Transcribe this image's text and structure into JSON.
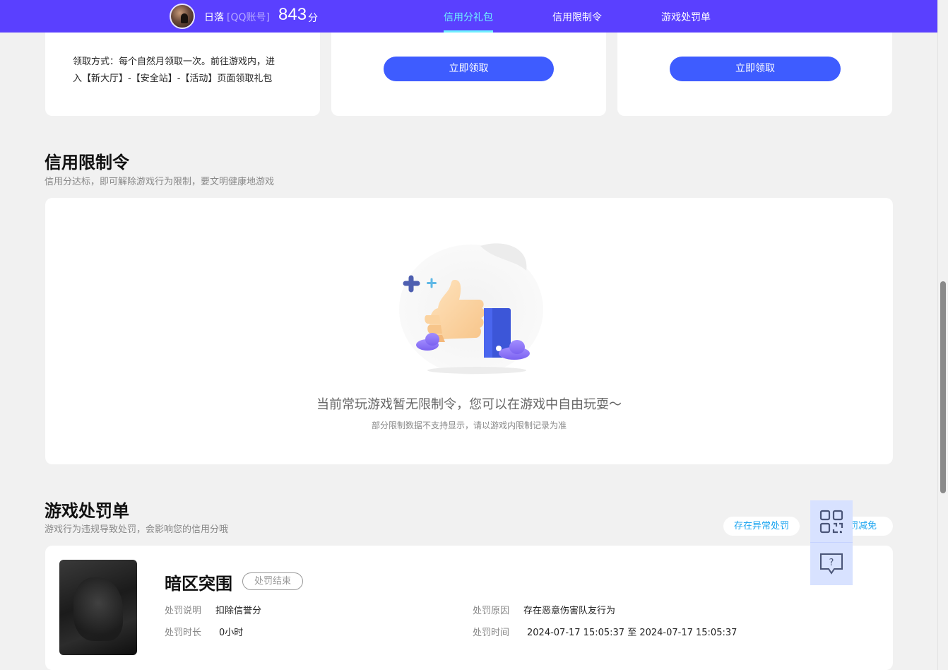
{
  "header": {
    "username": "日落",
    "account_tag": "[QQ账号]",
    "score": "843",
    "score_unit": "分",
    "tabs": [
      {
        "label": "信用分礼包",
        "active": true
      },
      {
        "label": "信用限制令",
        "active": false
      },
      {
        "label": "游戏处罚单",
        "active": false
      }
    ],
    "accent_color": "#5a40ff",
    "active_tab_color": "#6ff0ff"
  },
  "gift_cards": {
    "desc_line1": "领取方式：每个自然月领取一次。前往游戏内，进",
    "desc_line2": "入【新大厅】-【安全站】-【活动】页面领取礼包",
    "claim_label_1": "立即领取",
    "claim_label_2": "立即领取"
  },
  "restriction": {
    "title": "信用限制令",
    "subtitle": "信用分达标，即可解除游戏行为限制，要文明健康地游戏",
    "empty_main": "当前常玩游戏暂无限制令，您可以在游戏中自由玩耍～",
    "empty_sub": "部分限制数据不支持显示，请以游戏内限制记录为准"
  },
  "penalty": {
    "title": "游戏处罚单",
    "subtitle": "游戏行为违规导致处罚，会影响您的信用分哦",
    "pill_abnormal": "存在异常处罚",
    "pill_reduce": "罚减免",
    "record": {
      "game_title": "暗区突围",
      "status": "处罚结束",
      "desc_label": "处罚说明",
      "desc_value": "扣除信誉分",
      "reason_label": "处罚原因",
      "reason_value": "存在恶意伤害队友行为",
      "duration_label": "处罚时长",
      "duration_value": "0小时",
      "time_label": "处罚时间",
      "time_value": "2024-07-17 15:05:37 至 2024-07-17 15:05:37"
    }
  },
  "float_panel": {
    "icons": [
      "qrcode-icon",
      "feedback-icon"
    ]
  }
}
